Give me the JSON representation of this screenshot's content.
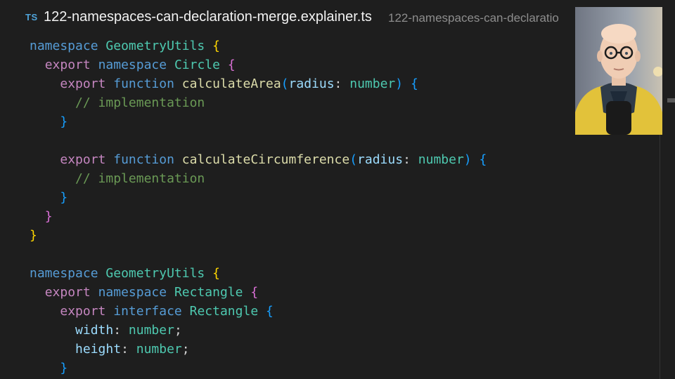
{
  "tab": {
    "badge": "TS",
    "title": "122-namespaces-can-declaration-merge.explainer.ts",
    "path": "122-namespaces-can-declaratio"
  },
  "code": {
    "lines": [
      {
        "tokens": [
          {
            "t": "namespace",
            "c": "kw"
          },
          {
            "t": " ",
            "c": "punct"
          },
          {
            "t": "GeometryUtils",
            "c": "ns"
          },
          {
            "t": " ",
            "c": "punct"
          },
          {
            "t": "{",
            "c": "b-gold"
          }
        ]
      },
      {
        "tokens": [
          {
            "t": "  ",
            "c": "punct"
          },
          {
            "t": "export",
            "c": "ctl"
          },
          {
            "t": " ",
            "c": "punct"
          },
          {
            "t": "namespace",
            "c": "kw"
          },
          {
            "t": " ",
            "c": "punct"
          },
          {
            "t": "Circle",
            "c": "ns"
          },
          {
            "t": " ",
            "c": "punct"
          },
          {
            "t": "{",
            "c": "b-pink"
          }
        ]
      },
      {
        "tokens": [
          {
            "t": "    ",
            "c": "punct"
          },
          {
            "t": "export",
            "c": "ctl"
          },
          {
            "t": " ",
            "c": "punct"
          },
          {
            "t": "function",
            "c": "kw"
          },
          {
            "t": " ",
            "c": "punct"
          },
          {
            "t": "calculateArea",
            "c": "fn"
          },
          {
            "t": "(",
            "c": "b-blue"
          },
          {
            "t": "radius",
            "c": "param"
          },
          {
            "t": ": ",
            "c": "punct"
          },
          {
            "t": "number",
            "c": "type"
          },
          {
            "t": ")",
            "c": "b-blue"
          },
          {
            "t": " ",
            "c": "punct"
          },
          {
            "t": "{",
            "c": "b-blue"
          }
        ]
      },
      {
        "tokens": [
          {
            "t": "      ",
            "c": "punct"
          },
          {
            "t": "// implementation",
            "c": "cmt"
          }
        ]
      },
      {
        "tokens": [
          {
            "t": "    ",
            "c": "punct"
          },
          {
            "t": "}",
            "c": "b-blue"
          }
        ]
      },
      {
        "tokens": []
      },
      {
        "tokens": [
          {
            "t": "    ",
            "c": "punct"
          },
          {
            "t": "export",
            "c": "ctl"
          },
          {
            "t": " ",
            "c": "punct"
          },
          {
            "t": "function",
            "c": "kw"
          },
          {
            "t": " ",
            "c": "punct"
          },
          {
            "t": "calculateCircumference",
            "c": "fn"
          },
          {
            "t": "(",
            "c": "b-blue"
          },
          {
            "t": "radius",
            "c": "param"
          },
          {
            "t": ": ",
            "c": "punct"
          },
          {
            "t": "number",
            "c": "type"
          },
          {
            "t": ")",
            "c": "b-blue"
          },
          {
            "t": " ",
            "c": "punct"
          },
          {
            "t": "{",
            "c": "b-blue"
          }
        ]
      },
      {
        "tokens": [
          {
            "t": "      ",
            "c": "punct"
          },
          {
            "t": "// implementation",
            "c": "cmt"
          }
        ]
      },
      {
        "tokens": [
          {
            "t": "    ",
            "c": "punct"
          },
          {
            "t": "}",
            "c": "b-blue"
          }
        ]
      },
      {
        "tokens": [
          {
            "t": "  ",
            "c": "punct"
          },
          {
            "t": "}",
            "c": "b-pink"
          }
        ]
      },
      {
        "tokens": [
          {
            "t": "}",
            "c": "b-gold"
          }
        ]
      },
      {
        "tokens": []
      },
      {
        "tokens": [
          {
            "t": "namespace",
            "c": "kw"
          },
          {
            "t": " ",
            "c": "punct"
          },
          {
            "t": "GeometryUtils",
            "c": "ns"
          },
          {
            "t": " ",
            "c": "punct"
          },
          {
            "t": "{",
            "c": "b-gold"
          }
        ]
      },
      {
        "tokens": [
          {
            "t": "  ",
            "c": "punct"
          },
          {
            "t": "export",
            "c": "ctl"
          },
          {
            "t": " ",
            "c": "punct"
          },
          {
            "t": "namespace",
            "c": "kw"
          },
          {
            "t": " ",
            "c": "punct"
          },
          {
            "t": "Rectangle",
            "c": "ns"
          },
          {
            "t": " ",
            "c": "punct"
          },
          {
            "t": "{",
            "c": "b-pink"
          }
        ]
      },
      {
        "tokens": [
          {
            "t": "    ",
            "c": "punct"
          },
          {
            "t": "export",
            "c": "ctl"
          },
          {
            "t": " ",
            "c": "punct"
          },
          {
            "t": "interface",
            "c": "kw"
          },
          {
            "t": " ",
            "c": "punct"
          },
          {
            "t": "Rectangle",
            "c": "type"
          },
          {
            "t": " ",
            "c": "punct"
          },
          {
            "t": "{",
            "c": "b-blue"
          }
        ]
      },
      {
        "tokens": [
          {
            "t": "      ",
            "c": "punct"
          },
          {
            "t": "width",
            "c": "param"
          },
          {
            "t": ": ",
            "c": "punct"
          },
          {
            "t": "number",
            "c": "type"
          },
          {
            "t": ";",
            "c": "punct"
          }
        ]
      },
      {
        "tokens": [
          {
            "t": "      ",
            "c": "punct"
          },
          {
            "t": "height",
            "c": "param"
          },
          {
            "t": ": ",
            "c": "punct"
          },
          {
            "t": "number",
            "c": "type"
          },
          {
            "t": ";",
            "c": "punct"
          }
        ]
      },
      {
        "tokens": [
          {
            "t": "    ",
            "c": "punct"
          },
          {
            "t": "}",
            "c": "b-blue"
          }
        ]
      }
    ]
  },
  "colors": {
    "background": "#1e1e1e",
    "keyword": "#569cd6",
    "control": "#c586c0",
    "namespace": "#4ec9b0",
    "function": "#dcdcaa",
    "parameter": "#9cdcfe",
    "comment": "#6a9955",
    "bracket_level1": "#ffd700",
    "bracket_level2": "#da70d6",
    "bracket_level3": "#179fff"
  }
}
